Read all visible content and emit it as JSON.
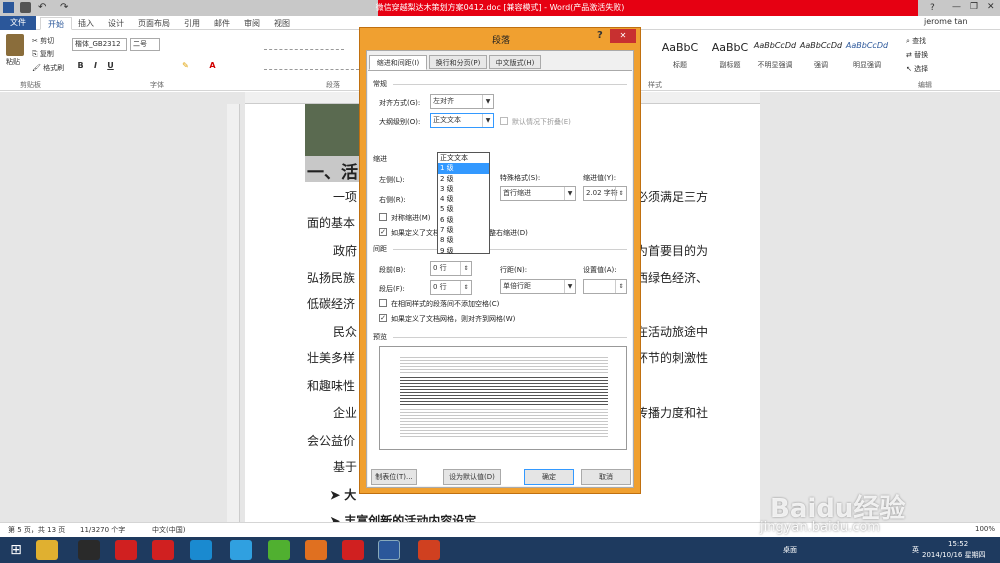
{
  "window": {
    "title": "微信穿越梨达木策划方案0412.doc [兼容模式] - Word(产品激活失败)",
    "user": "jerome tan"
  },
  "tabs": [
    "文件",
    "开始",
    "插入",
    "设计",
    "页面布局",
    "引用",
    "邮件",
    "审阅",
    "视图"
  ],
  "ribbon": {
    "clipboard": {
      "paste": "粘贴",
      "cut": "剪切",
      "copy": "复制",
      "format_painter": "格式刷",
      "label": "剪贴板"
    },
    "font": {
      "name": "楷体_GB2312",
      "size": "二号",
      "label": "字体"
    },
    "paragraph_label": "段落",
    "styles_label": "样式",
    "styles": [
      {
        "preview": "AaBbC",
        "name": "标题"
      },
      {
        "preview": "AaBbC",
        "name": "副标题"
      },
      {
        "preview": "AaBbCcDd",
        "name": "不明显强调"
      },
      {
        "preview": "AaBbCcDd",
        "name": "强调"
      },
      {
        "preview": "AaBbCcDd",
        "name": "明显强调"
      }
    ],
    "editing": {
      "find": "查找",
      "replace": "替换",
      "select": "选择",
      "label": "编辑"
    }
  },
  "document": {
    "heading": "一、活",
    "lines": [
      {
        "left": "一项",
        "right": "必须满足三方"
      },
      {
        "left": "面的基本",
        "right": ""
      },
      {
        "left": "政府",
        "right": "为首要目的为"
      },
      {
        "left": "弘扬民族",
        "right": "江西绿色经济、"
      },
      {
        "left": "低碳经济",
        "right": ""
      },
      {
        "left": "民众",
        "right": "在活动旅途中"
      },
      {
        "left": "壮美多样",
        "right": "环节的刺激性"
      },
      {
        "left": "和趣味性",
        "right": ""
      },
      {
        "left": "企业",
        "right": "的传播力度和社"
      },
      {
        "left": "会公益价",
        "right": ""
      },
      {
        "left": "基于",
        "right": ""
      },
      {
        "left": "➤ 大",
        "right": ""
      },
      {
        "left": "➤ 丰富创新的活动内容设定。",
        "right": ""
      }
    ]
  },
  "statusbar": {
    "page": "第 5 页，共 13 页",
    "words": "11/3270 个字",
    "lang": "中文(中国)",
    "zoom": "100%"
  },
  "taskbar": {
    "desktop": "桌面",
    "ime": "英",
    "time": "15:52",
    "date": "2014/10/16 星期四"
  },
  "watermark": {
    "text": "Baidu经验",
    "url": "jingyan.baidu.com"
  },
  "dialog": {
    "title": "段落",
    "help": "?",
    "tabs": [
      "缩进和间距(I)",
      "换行和分页(P)",
      "中文版式(H)"
    ],
    "general": {
      "section": "常规",
      "align_label": "对齐方式(G):",
      "align_value": "左对齐",
      "outline_label": "大纲级别(O):",
      "outline_value": "正文文本",
      "collapse_label": "默认情况下折叠(E)"
    },
    "outline_options": [
      "正文文本",
      "1 级",
      "2 级",
      "3 级",
      "4 级",
      "5 级",
      "6 级",
      "7 级",
      "8 级",
      "9 级"
    ],
    "indent": {
      "section": "缩进",
      "left_label": "左侧(L):",
      "right_label": "右侧(R):",
      "special_label": "特殊格式(S):",
      "special_value": "首行缩进",
      "by_label": "缩进值(Y):",
      "by_value": "2.02 字符",
      "mirror_label": "对称缩进(M)",
      "auto_label": "如果定义了文档网格，则自动调整右缩进(D)"
    },
    "spacing": {
      "section": "间距",
      "before_label": "段前(B):",
      "before_value": "0 行",
      "after_label": "段后(F):",
      "after_value": "0 行",
      "line_label": "行距(N):",
      "line_value": "单倍行距",
      "at_label": "设置值(A):",
      "no_space_label": "在相同样式的段落间不添加空格(C)",
      "grid_label": "如果定义了文档网格，则对齐到网格(W)"
    },
    "preview": {
      "section": "预览"
    },
    "buttons": {
      "tabs": "制表位(T)...",
      "default": "设为默认值(D)",
      "ok": "确定",
      "cancel": "取消"
    }
  },
  "colors": {
    "accent": "#2b579a",
    "title_red": "#e60012",
    "dialog_border": "#f0a030",
    "dropdown_sel": "#3399ff"
  }
}
